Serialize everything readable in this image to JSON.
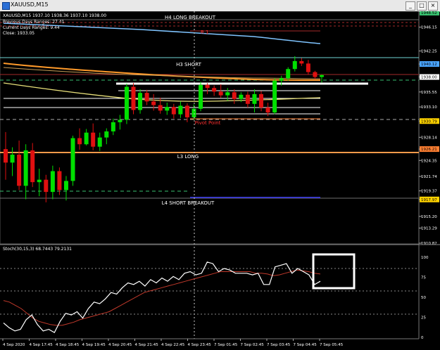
{
  "window": {
    "title": "XAUUSD,M15",
    "btn_min": "_",
    "btn_max": "□",
    "btn_close": "×"
  },
  "info": {
    "symbol_line": "XAUUSD,M15  1937.10 1938.36 1937.10 1938.00",
    "previous_range": "Previous Days Ranges: 27.41",
    "current_range": "Current Days Ranges: 9.44",
    "close_line": "Close: 1933.05"
  },
  "levels": {
    "h4": "H4 LONG BREAKOUT",
    "h3": "H3 SHORT",
    "r1": "R 1",
    "pivot": "Pivot Point",
    "l3": "L3 LONG",
    "l4": "L4 SHORT BREAKOUT"
  },
  "price_axis": {
    "ticks": [
      "1946.15",
      "1942.25",
      "1940.12",
      "1938.00",
      "1935.55",
      "1933.10",
      "1930.79",
      "1928.14",
      "1926.21",
      "1924.35",
      "1921.74",
      "1919.37",
      "1917.97",
      "1915.20",
      "1913.29",
      "1910.82"
    ],
    "tags": [
      {
        "label": "1948.52",
        "color": "#39c16f"
      },
      {
        "label": "1940.12",
        "color": "#4aa5ff"
      },
      {
        "label": "1938.00",
        "color": "#ffffff"
      },
      {
        "label": "1930.79",
        "color": "#ffd200"
      },
      {
        "label": "1926.21",
        "color": "#ff7f32"
      },
      {
        "label": "1917.97",
        "color": "#ffd200"
      }
    ]
  },
  "stoch": {
    "label": "Stoch(30,15,3) 68.7443 79.2131",
    "ticks": [
      "100",
      "75",
      "50",
      "25",
      "0"
    ]
  },
  "time_axis": {
    "labels": [
      "4 Sep 2020",
      "4 Sep 17:45",
      "4 Sep 18:45",
      "4 Sep 19:45",
      "4 Sep 20:45",
      "4 Sep 21:45",
      "4 Sep 22:45",
      "4 Sep 23:45",
      "7 Sep 01:45",
      "7 Sep 02:45",
      "7 Sep 03:45",
      "7 Sep 04:45",
      "7 Sep 05:45"
    ]
  },
  "chart_data": {
    "type": "candlestick",
    "y_range": [
      1910.82,
      1948.52
    ],
    "candles": [
      {
        "o": 1926.2,
        "h": 1929.0,
        "l": 1921.2,
        "c": 1924.0,
        "bull": false
      },
      {
        "o": 1924.0,
        "h": 1926.5,
        "l": 1921.8,
        "c": 1925.3,
        "bull": true
      },
      {
        "o": 1925.3,
        "h": 1927.6,
        "l": 1919.5,
        "c": 1920.2,
        "bull": false
      },
      {
        "o": 1920.2,
        "h": 1927.0,
        "l": 1918.0,
        "c": 1926.0,
        "bull": true
      },
      {
        "o": 1926.0,
        "h": 1927.2,
        "l": 1920.0,
        "c": 1920.8,
        "bull": false
      },
      {
        "o": 1920.8,
        "h": 1923.0,
        "l": 1918.5,
        "c": 1921.2,
        "bull": true
      },
      {
        "o": 1921.2,
        "h": 1922.0,
        "l": 1917.5,
        "c": 1919.2,
        "bull": false
      },
      {
        "o": 1919.2,
        "h": 1923.5,
        "l": 1918.0,
        "c": 1922.6,
        "bull": true
      },
      {
        "o": 1922.6,
        "h": 1923.2,
        "l": 1918.7,
        "c": 1919.5,
        "bull": false
      },
      {
        "o": 1919.5,
        "h": 1921.8,
        "l": 1917.8,
        "c": 1921.0,
        "bull": true
      },
      {
        "o": 1921.0,
        "h": 1928.4,
        "l": 1920.2,
        "c": 1928.0,
        "bull": true
      },
      {
        "o": 1928.0,
        "h": 1929.6,
        "l": 1926.1,
        "c": 1927.0,
        "bull": false
      },
      {
        "o": 1927.0,
        "h": 1929.5,
        "l": 1926.8,
        "c": 1928.9,
        "bull": true
      },
      {
        "o": 1928.9,
        "h": 1930.4,
        "l": 1926.0,
        "c": 1926.6,
        "bull": false
      },
      {
        "o": 1926.6,
        "h": 1928.9,
        "l": 1925.9,
        "c": 1928.1,
        "bull": true
      },
      {
        "o": 1928.1,
        "h": 1929.6,
        "l": 1927.0,
        "c": 1929.1,
        "bull": true
      },
      {
        "o": 1929.1,
        "h": 1931.2,
        "l": 1928.5,
        "c": 1930.6,
        "bull": true
      },
      {
        "o": 1930.6,
        "h": 1931.8,
        "l": 1929.4,
        "c": 1931.0,
        "bull": true
      },
      {
        "o": 1931.0,
        "h": 1936.9,
        "l": 1930.3,
        "c": 1936.4,
        "bull": true
      },
      {
        "o": 1936.4,
        "h": 1937.0,
        "l": 1931.9,
        "c": 1932.6,
        "bull": false
      },
      {
        "o": 1932.6,
        "h": 1936.0,
        "l": 1932.0,
        "c": 1935.4,
        "bull": true
      },
      {
        "o": 1935.4,
        "h": 1935.9,
        "l": 1933.4,
        "c": 1934.0,
        "bull": false
      },
      {
        "o": 1934.0,
        "h": 1935.2,
        "l": 1932.5,
        "c": 1933.4,
        "bull": false
      },
      {
        "o": 1933.4,
        "h": 1934.6,
        "l": 1932.0,
        "c": 1932.5,
        "bull": false
      },
      {
        "o": 1932.5,
        "h": 1933.8,
        "l": 1931.8,
        "c": 1933.1,
        "bull": true
      },
      {
        "o": 1933.1,
        "h": 1933.6,
        "l": 1931.2,
        "c": 1931.9,
        "bull": false
      },
      {
        "o": 1931.9,
        "h": 1934.0,
        "l": 1931.3,
        "c": 1933.3,
        "bull": true
      },
      {
        "o": 1933.3,
        "h": 1933.7,
        "l": 1930.6,
        "c": 1931.4,
        "bull": false
      },
      {
        "o": 1931.4,
        "h": 1933.5,
        "l": 1931.0,
        "c": 1932.8,
        "bull": true
      },
      {
        "o": 1932.8,
        "h": 1937.2,
        "l": 1932.4,
        "c": 1936.7,
        "bull": true
      },
      {
        "o": 1936.7,
        "h": 1937.0,
        "l": 1935.2,
        "c": 1936.2,
        "bull": false
      },
      {
        "o": 1936.2,
        "h": 1936.6,
        "l": 1934.9,
        "c": 1935.6,
        "bull": false
      },
      {
        "o": 1935.6,
        "h": 1936.8,
        "l": 1934.6,
        "c": 1935.0,
        "bull": false
      },
      {
        "o": 1935.0,
        "h": 1936.2,
        "l": 1934.1,
        "c": 1935.5,
        "bull": true
      },
      {
        "o": 1935.5,
        "h": 1936.0,
        "l": 1933.6,
        "c": 1934.4,
        "bull": false
      },
      {
        "o": 1934.4,
        "h": 1935.5,
        "l": 1933.9,
        "c": 1935.1,
        "bull": true
      },
      {
        "o": 1935.1,
        "h": 1935.6,
        "l": 1933.0,
        "c": 1933.6,
        "bull": false
      },
      {
        "o": 1933.6,
        "h": 1936.0,
        "l": 1932.2,
        "c": 1935.2,
        "bull": true
      },
      {
        "o": 1935.2,
        "h": 1935.7,
        "l": 1932.4,
        "c": 1933.0,
        "bull": false
      },
      {
        "o": 1933.0,
        "h": 1933.8,
        "l": 1931.6,
        "c": 1932.2,
        "bull": false
      },
      {
        "o": 1932.2,
        "h": 1937.8,
        "l": 1931.9,
        "c": 1937.4,
        "bull": true
      },
      {
        "o": 1937.4,
        "h": 1938.2,
        "l": 1936.6,
        "c": 1937.8,
        "bull": true
      },
      {
        "o": 1937.8,
        "h": 1939.6,
        "l": 1937.4,
        "c": 1939.3,
        "bull": true
      },
      {
        "o": 1939.3,
        "h": 1941.4,
        "l": 1938.9,
        "c": 1940.6,
        "bull": true
      },
      {
        "o": 1940.6,
        "h": 1941.1,
        "l": 1939.8,
        "c": 1940.2,
        "bull": false
      },
      {
        "o": 1940.2,
        "h": 1940.8,
        "l": 1938.4,
        "c": 1938.8,
        "bull": false
      },
      {
        "o": 1938.8,
        "h": 1939.0,
        "l": 1937.6,
        "c": 1938.0,
        "bull": false
      },
      {
        "o": 1938.0,
        "h": 1938.4,
        "l": 1937.1,
        "c": 1938.3,
        "bull": true
      }
    ],
    "stoch_k": [
      18,
      12,
      8,
      10,
      22,
      28,
      16,
      8,
      10,
      6,
      20,
      30,
      28,
      32,
      24,
      36,
      44,
      42,
      48,
      56,
      54,
      62,
      68,
      66,
      70,
      64,
      72,
      68,
      74,
      70,
      76,
      72,
      80,
      82,
      78,
      80,
      94,
      92,
      82,
      86,
      84,
      80,
      80,
      80,
      78,
      80,
      66,
      66,
      88,
      90,
      92,
      80,
      86,
      82,
      78,
      66,
      70
    ],
    "stoch_d": [
      46,
      44,
      40,
      36,
      30,
      24,
      20,
      18,
      16,
      15,
      15,
      17,
      19,
      22,
      24,
      26,
      28,
      30,
      32,
      36,
      40,
      44,
      48,
      52,
      56,
      58,
      60,
      62,
      64,
      66,
      68,
      70,
      72,
      74,
      76,
      78,
      80,
      82,
      82,
      82,
      82,
      82,
      82,
      80,
      80,
      79,
      77,
      78,
      80,
      82,
      84,
      83,
      82,
      80,
      79
    ]
  }
}
